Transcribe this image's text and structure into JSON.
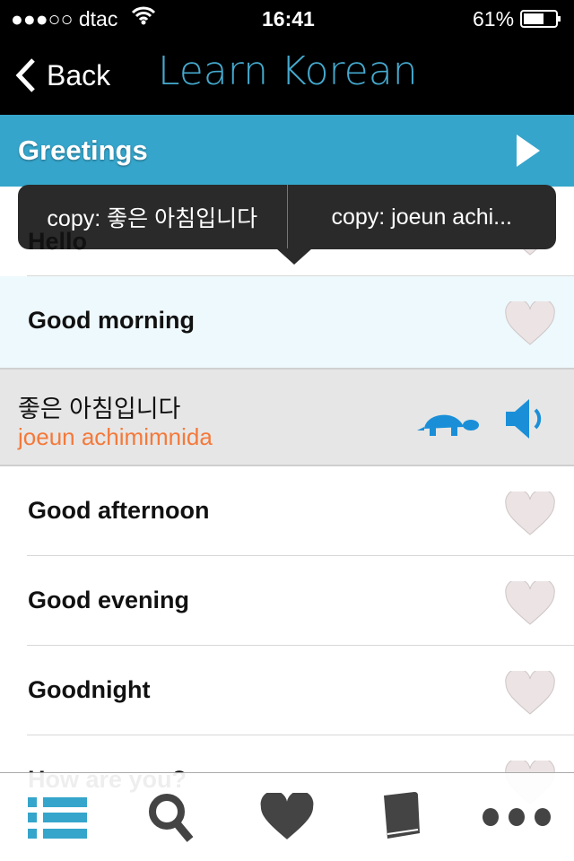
{
  "status": {
    "carrier": "●●●○○ dtac",
    "time": "16:41",
    "battery": "61%",
    "battery_level": 0.61
  },
  "nav": {
    "back": "Back",
    "title": "Learn Korean"
  },
  "section": {
    "title": "Greetings"
  },
  "popup": {
    "copy_korean": "copy: 좋은 아침입니다",
    "copy_roman": "copy: joeun achi..."
  },
  "rows": [
    {
      "label": "Hello"
    },
    {
      "label": "Good morning"
    },
    {
      "label": "Good afternoon"
    },
    {
      "label": "Good evening"
    },
    {
      "label": "Goodnight"
    },
    {
      "label": "How are you?"
    }
  ],
  "detail": {
    "korean": "좋은 아침입니다",
    "romanization": "joeun achimimnida"
  },
  "colors": {
    "accent": "#35a5cb",
    "romanization": "#f4793a",
    "icon_blue": "#1a8fd8"
  },
  "tabs": [
    "list-icon",
    "search-icon",
    "heart-icon",
    "book-icon",
    "more-icon"
  ]
}
